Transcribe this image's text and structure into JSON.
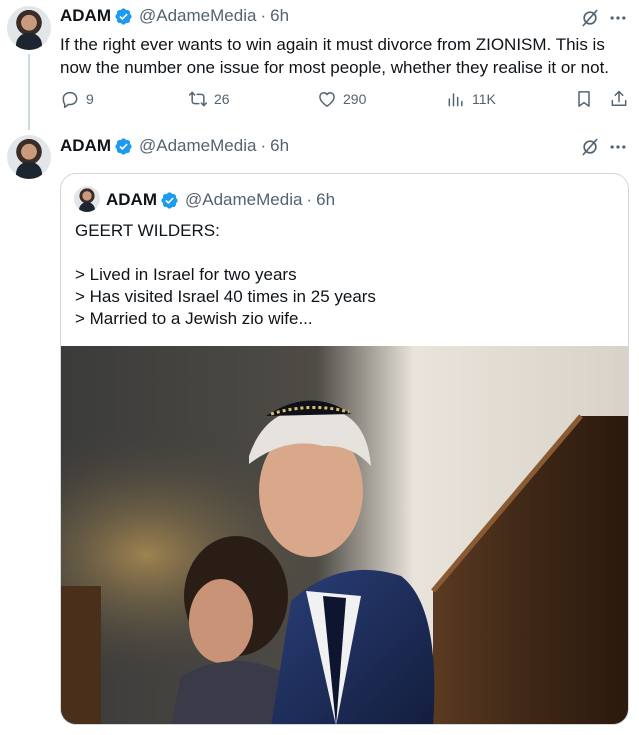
{
  "tweets": [
    {
      "author_name": "ADAM",
      "handle": "@AdameMedia",
      "separator": "·",
      "time": "6h",
      "text": "If the right ever wants to win again it must divorce from ZIONISM. This is now the number one issue for most people, whether they realise it or not.",
      "stats": {
        "replies": "9",
        "reposts": "26",
        "likes": "290",
        "views": "11K"
      }
    },
    {
      "author_name": "ADAM",
      "handle": "@AdameMedia",
      "separator": "·",
      "time": "6h",
      "quote": {
        "author_name": "ADAM",
        "handle": "@AdameMedia",
        "separator": "·",
        "time": "6h",
        "lines": [
          "GEERT WILDERS:",
          "",
          "> Lived in Israel for two years",
          "> Has visited Israel 40 times in 25 years",
          "> Married to a Jewish zio wife..."
        ]
      }
    }
  ],
  "icons": {
    "verified": "verified-badge-icon",
    "grok": "grok-icon",
    "more": "more-icon",
    "reply": "reply-icon",
    "repost": "repost-icon",
    "like": "like-icon",
    "views": "views-icon",
    "bookmark": "bookmark-icon",
    "share": "share-icon"
  },
  "colors": {
    "verified": "#1d9bf0",
    "secondary_text": "#536471",
    "border": "#cfd9de"
  }
}
